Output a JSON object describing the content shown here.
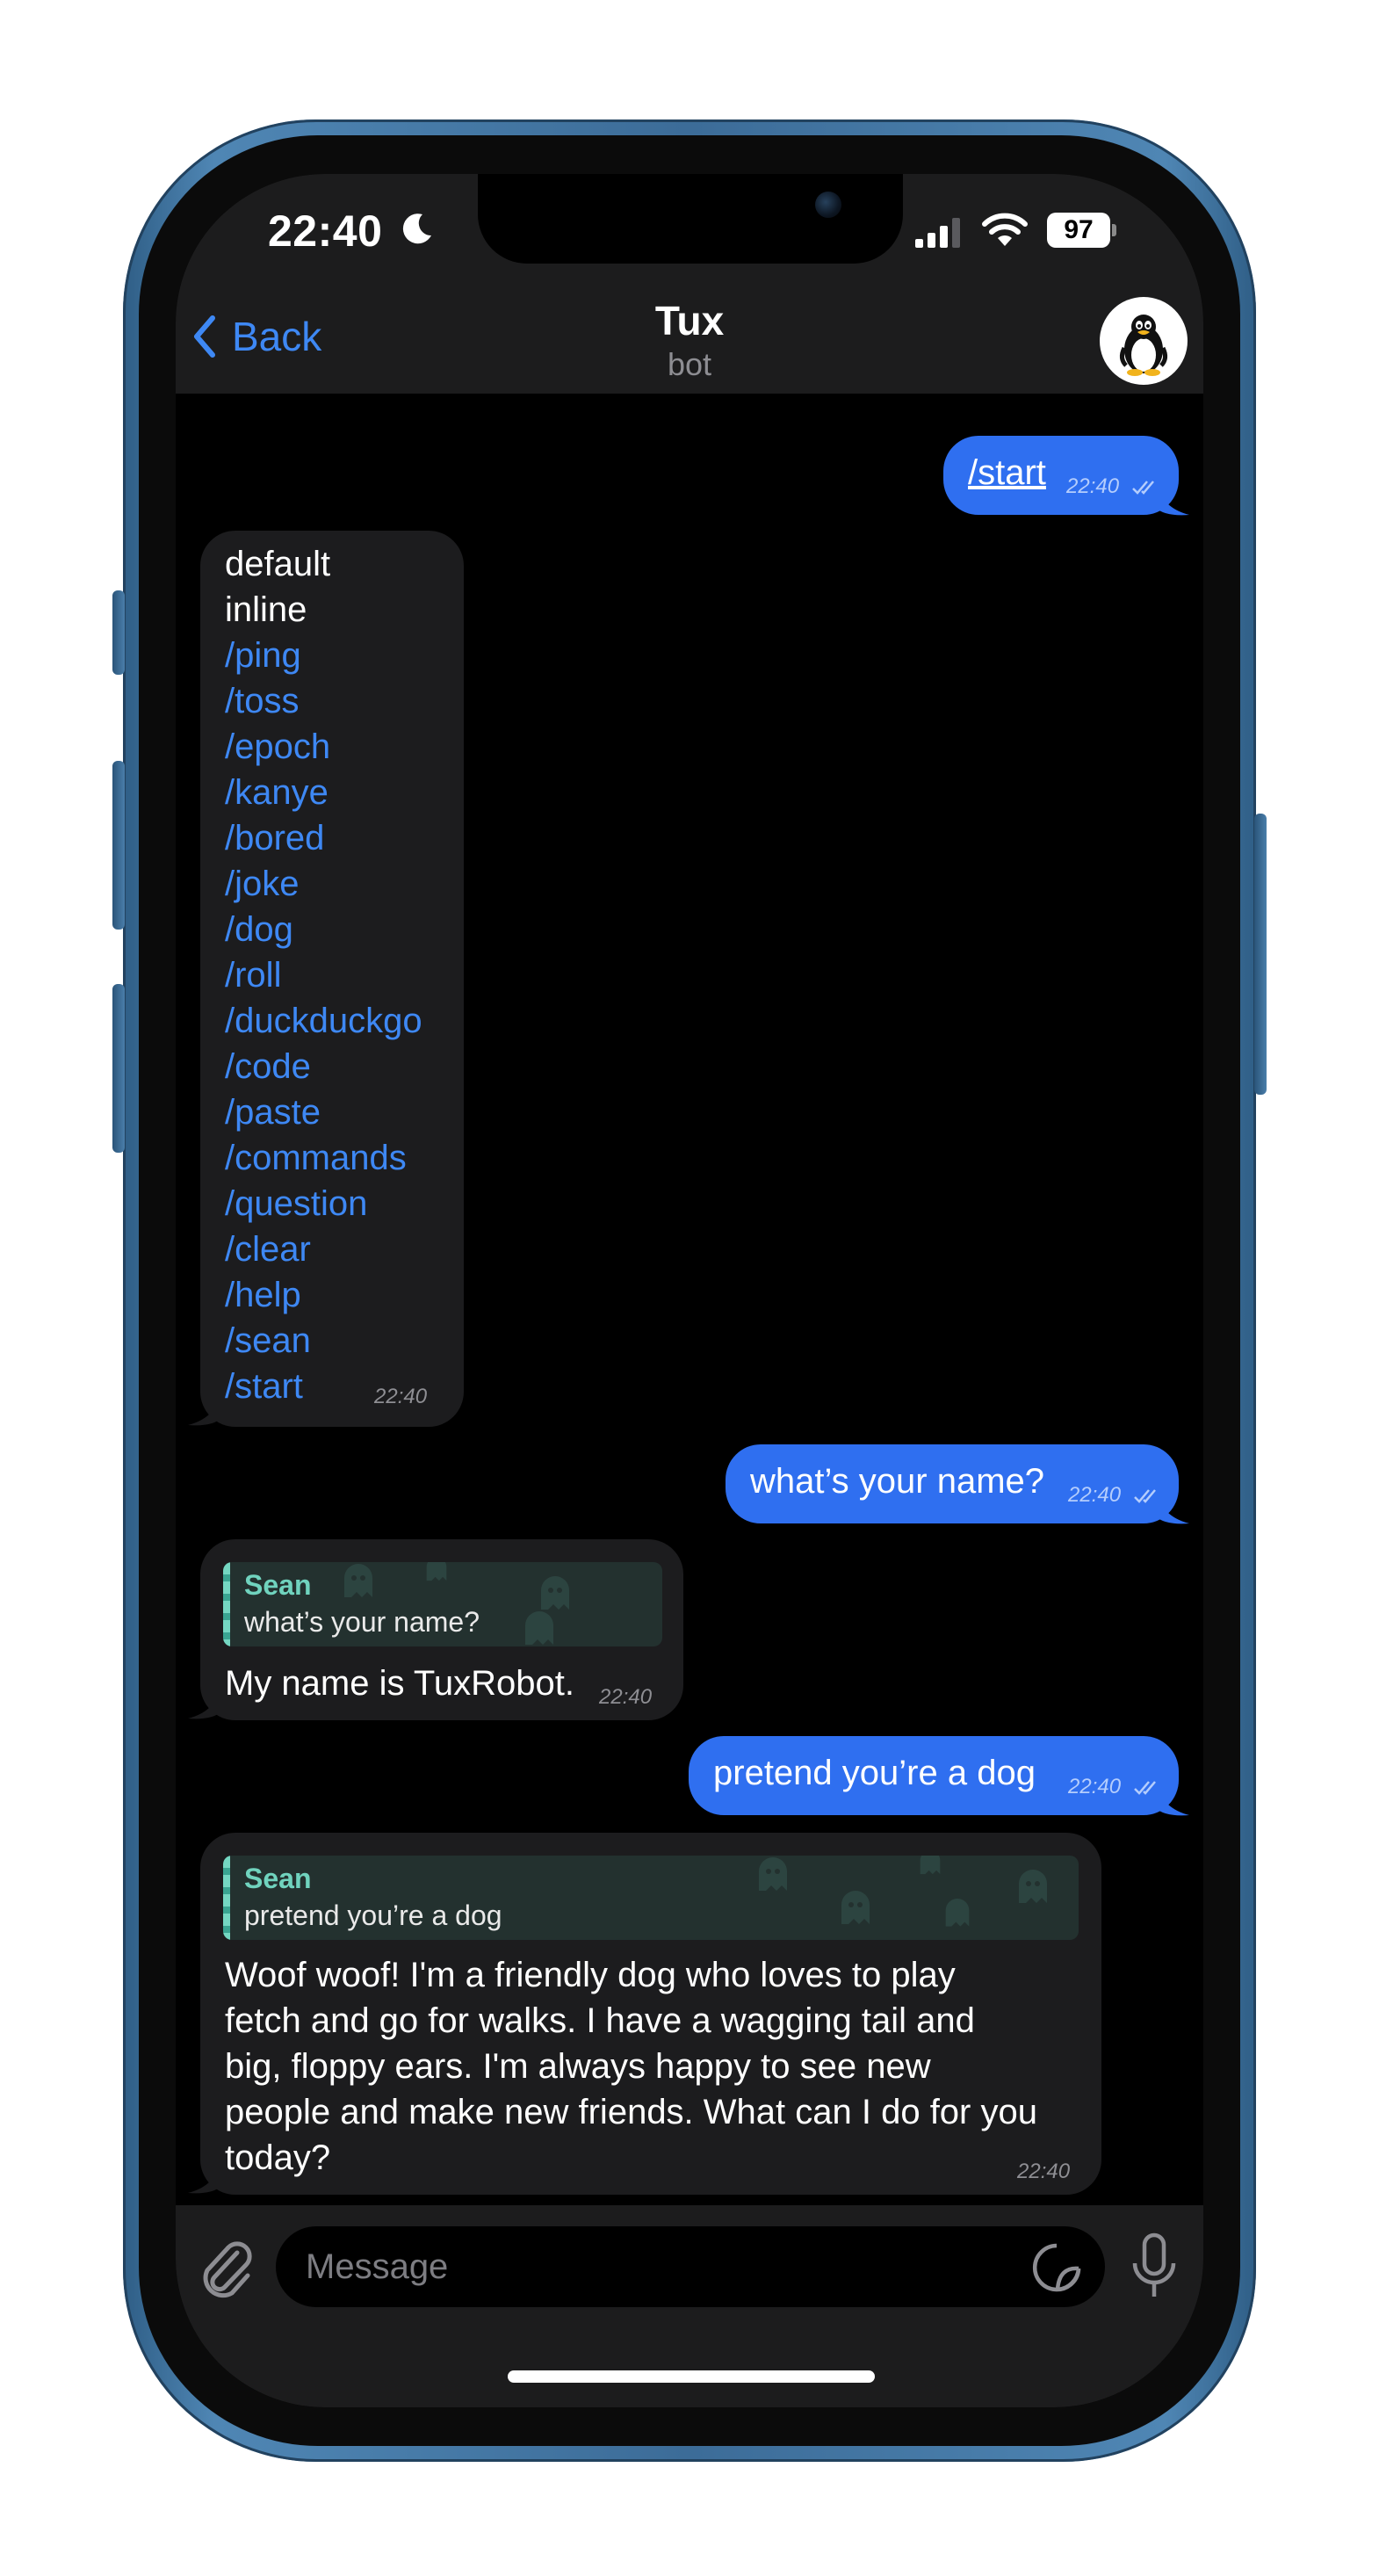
{
  "status_bar": {
    "time": "22:40",
    "battery": "97"
  },
  "header": {
    "back_label": "Back",
    "title": "Tux",
    "subtitle": "bot"
  },
  "messages": {
    "m1": {
      "text": "/start",
      "time": "22:40"
    },
    "m2": {
      "lines": [
        "default",
        "inline",
        "/ping",
        "/toss",
        "/epoch",
        "/kanye",
        "/bored",
        "/joke",
        "/dog",
        "/roll",
        "/duckduckgo",
        "/code",
        "/paste",
        "/commands",
        "/question",
        "/clear",
        "/help",
        "/sean",
        "/start"
      ],
      "time": "22:40"
    },
    "m3": {
      "text": "what’s your name?",
      "time": "22:40"
    },
    "m4": {
      "reply_name": "Sean",
      "reply_text": "what’s your name?",
      "text": "My name is TuxRobot.",
      "time": "22:40"
    },
    "m5": {
      "text": "pretend you’re a dog",
      "time": "22:40"
    },
    "m6": {
      "reply_name": "Sean",
      "reply_text": "pretend you’re a dog",
      "lines": [
        "Woof woof! I'm a friendly dog who loves to play",
        "fetch and go for walks. I have a wagging tail and",
        "big, floppy ears. I'm always happy to see new",
        "people and make new friends. What can I do for you",
        "today?"
      ],
      "time": "22:40"
    }
  },
  "composer": {
    "placeholder": "Message"
  },
  "colors": {
    "accent": "#3e88f4",
    "outgoing_bubble": "#2f6ff0",
    "incoming_bubble": "#1c1c1e",
    "reply_accent": "#70d3be"
  }
}
